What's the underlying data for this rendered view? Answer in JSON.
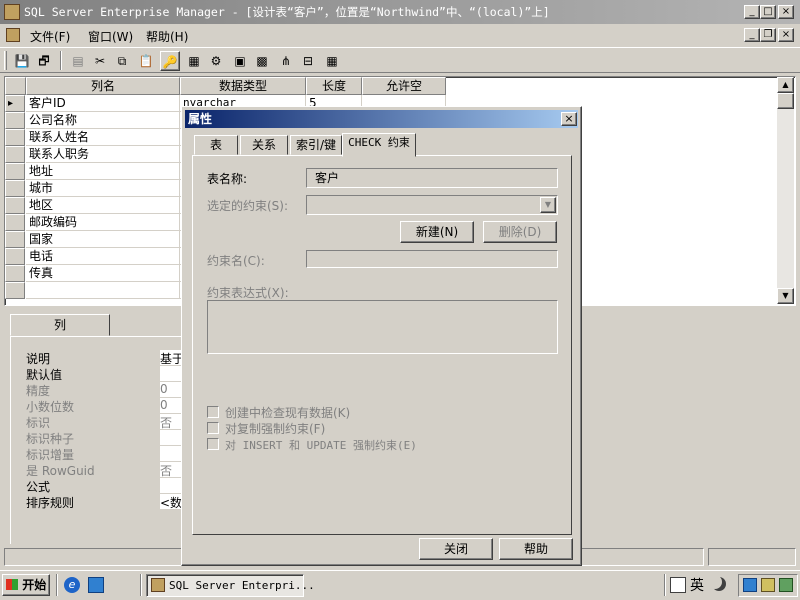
{
  "window": {
    "title": "SQL Server Enterprise Manager - [设计表“客户”，位置是“Northwind”中、“(local)”上]",
    "min_label": "_",
    "max_label": "□",
    "close_label": "×"
  },
  "menu": {
    "items": [
      "文件(F)",
      "窗口(W)",
      "帮助(H)"
    ],
    "mdi_min": "_",
    "mdi_restore": "❐",
    "mdi_close": "×"
  },
  "grid": {
    "headers": [
      "列名",
      "数据类型",
      "长度",
      "允许空"
    ],
    "rows": [
      {
        "name": "客户ID",
        "type": "nvarchar",
        "length": "5"
      },
      {
        "name": "公司名称",
        "type": "",
        "length": ""
      },
      {
        "name": "联系人姓名",
        "type": "",
        "length": ""
      },
      {
        "name": "联系人职务",
        "type": "",
        "length": ""
      },
      {
        "name": "地址",
        "type": "",
        "length": ""
      },
      {
        "name": "城市",
        "type": "",
        "length": ""
      },
      {
        "name": "地区",
        "type": "",
        "length": ""
      },
      {
        "name": "邮政编码",
        "type": "",
        "length": ""
      },
      {
        "name": "国家",
        "type": "",
        "length": ""
      },
      {
        "name": "电话",
        "type": "",
        "length": ""
      },
      {
        "name": "传真",
        "type": "",
        "length": ""
      }
    ],
    "key_icon": "key-icon"
  },
  "columns_pane": {
    "tab_label": "列",
    "props": [
      {
        "label": "说明",
        "value": "基于",
        "enabled": true
      },
      {
        "label": "默认值",
        "value": "",
        "enabled": true
      },
      {
        "label": "精度",
        "value": "0",
        "enabled": false
      },
      {
        "label": "小数位数",
        "value": "0",
        "enabled": false
      },
      {
        "label": "标识",
        "value": "否",
        "enabled": false
      },
      {
        "label": "标识种子",
        "value": "",
        "enabled": false
      },
      {
        "label": "标识增量",
        "value": "",
        "enabled": false
      },
      {
        "label": "是 RowGuid",
        "value": "否",
        "enabled": false
      },
      {
        "label": "公式",
        "value": "",
        "enabled": true
      },
      {
        "label": "排序规则",
        "value": "<数据",
        "enabled": true
      }
    ]
  },
  "dialog": {
    "title": "属性",
    "close_label": "×",
    "tabs": [
      "表",
      "关系",
      "索引/键",
      "CHECK 约束"
    ],
    "table_name_label": "表名称:",
    "table_name_value": "客户",
    "selected_constraint_label": "选定的约束(S):",
    "new_button": "新建(N)",
    "delete_button": "删除(D)",
    "constraint_name_label": "约束名(C):",
    "constraint_expr_label": "约束表达式(X):",
    "checkboxes": [
      "创建中检查现有数据(K)",
      "对复制强制约束(F)",
      "对 INSERT 和 UPDATE 强制约束(E)"
    ],
    "close_button": "关闭",
    "help_button": "帮助"
  },
  "taskbar": {
    "start_label": "开始",
    "task_label": "SQL Server Enterpri...",
    "ime_label": "英"
  }
}
